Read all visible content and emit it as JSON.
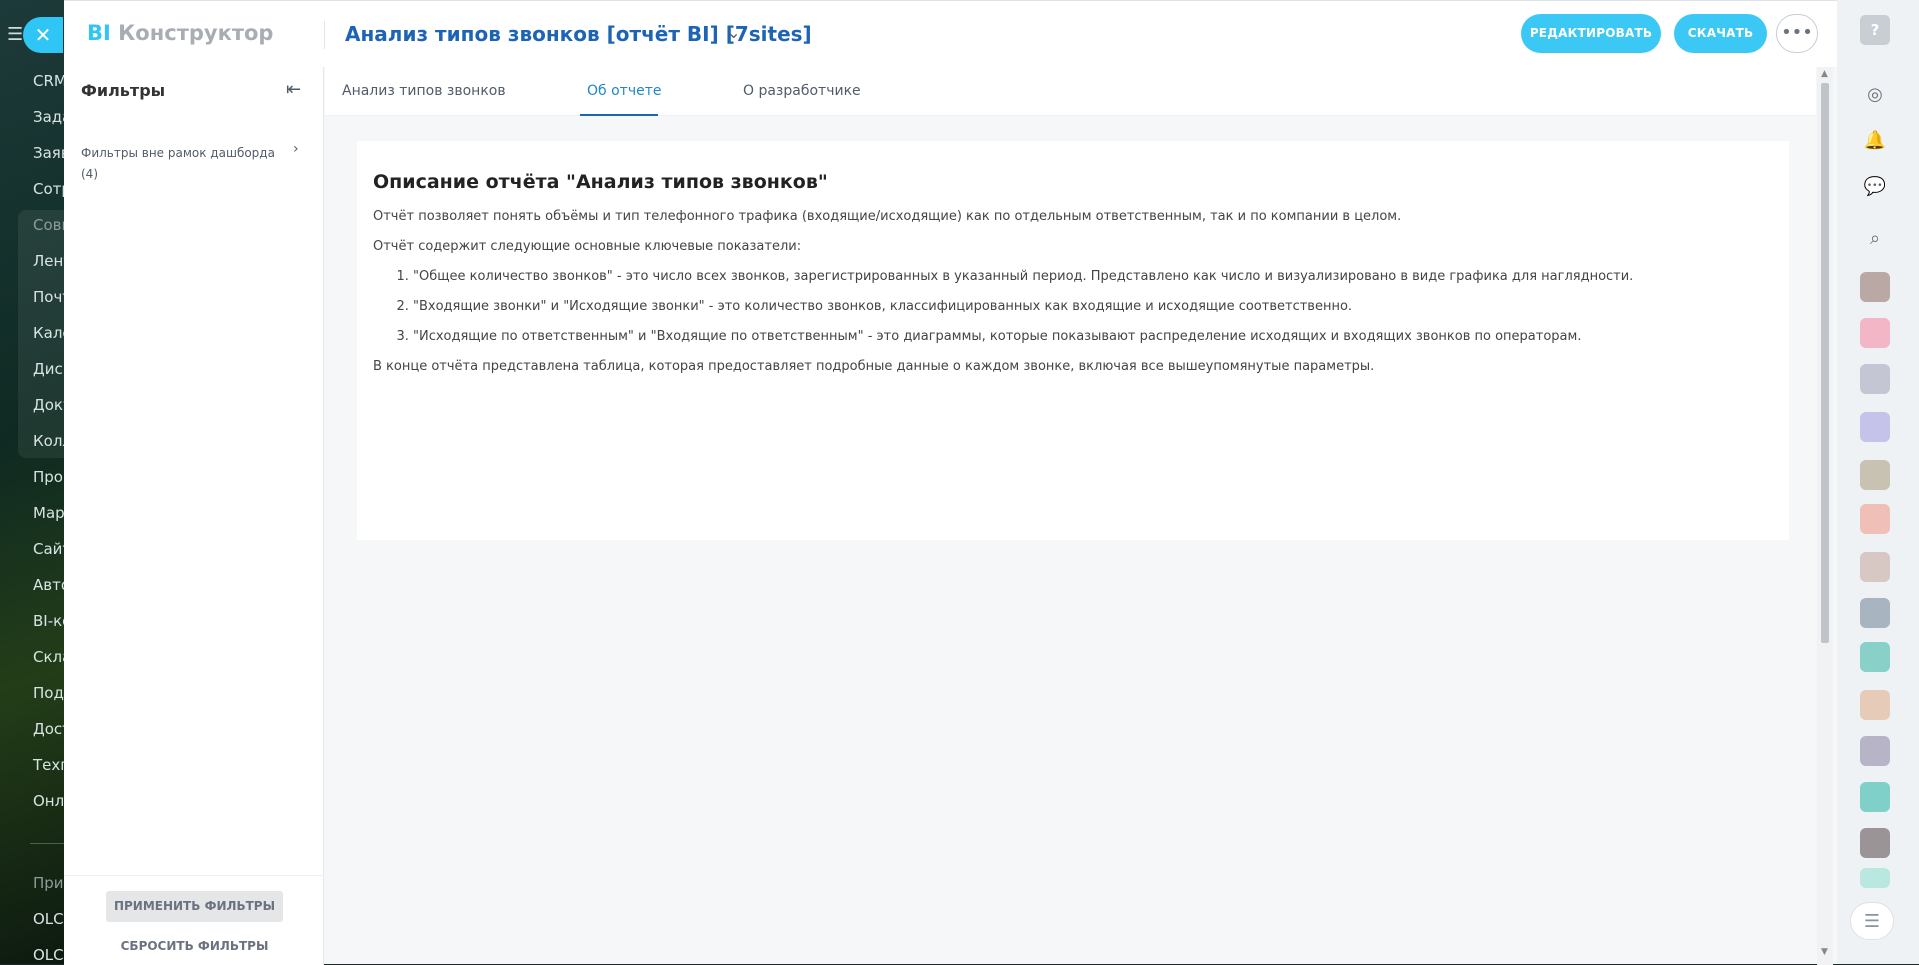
{
  "bg_nav": {
    "items": [
      "CRM",
      "Зада",
      "Заяв",
      "Сотр",
      "Совм",
      "Лент",
      "Почт",
      "Кале",
      "Диск",
      "Доку",
      "Колл",
      "Про",
      "Мар",
      "Сайт",
      "Авто",
      "BI-ко",
      "Скла",
      "Подп",
      "Дост",
      "Техп",
      "Онла",
      "Прил",
      "OLCI",
      "OLCI"
    ]
  },
  "header": {
    "logo_bi": "BI",
    "logo_text": "Конструктор",
    "title": "Анализ типов звонков [отчёт BI] [7sites]",
    "edit_label": "РЕДАКТИРОВАТЬ",
    "download_label": "СКАЧАТЬ"
  },
  "filters": {
    "title": "Фильтры",
    "item": "Фильтры вне рамок дашборда (4)",
    "apply": "ПРИМЕНИТЬ ФИЛЬТРЫ",
    "reset": "СБРОСИТЬ ФИЛЬТРЫ"
  },
  "tabs": [
    {
      "label": "Анализ типов звонков"
    },
    {
      "label": "Об отчете"
    },
    {
      "label": "О разработчике"
    }
  ],
  "content": {
    "title": "Описание отчёта \"Анализ типов звонков\"",
    "intro": "Отчёт позволяет понять объёмы и тип телефонного трафика (входящие/исходящие) как по отдельным ответственным, так и по компании в целом.",
    "list_intro": "Отчёт содержит следующие основные ключевые показатели:",
    "list": [
      "\"Общее количество звонков\" - это число всех звонков, зарегистрированных в указанный период. Представлено как число и визуализировано в виде графика для наглядности.",
      "\"Входящие звонки\" и \"Исходящие звонки\" - это количество звонков, классифицированных как входящие и исходящие соответственно.",
      "\"Исходящие по ответственным\" и \"Входящие по ответственным\" - это диаграммы, которые показывают распределение исходящих и входящих звонков по операторам."
    ],
    "outro": "В конце отчёта представлена таблица, которая предоставляет подробные данные о каждом звонке, включая все вышеупомянутые параметры."
  },
  "colors": {
    "accent": "#2fc6f6",
    "title": "#1e64b4"
  }
}
